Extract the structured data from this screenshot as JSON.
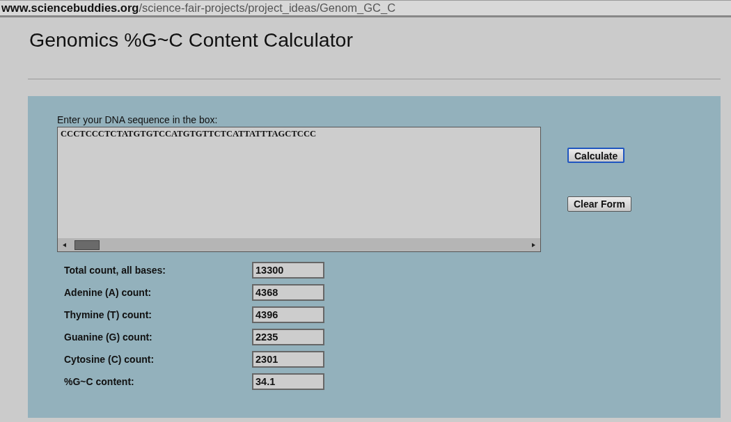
{
  "address_bar": {
    "domain": "www.sciencebuddies.org",
    "path": "/science-fair-projects/project_ideas/Genom_GC_C"
  },
  "page_title": "Genomics %G~C Content Calculator",
  "form": {
    "sequence_label": "Enter your DNA sequence in the box:",
    "sequence_value": "CCCTCCCTCTATGTGTCCATGTGTTCTCATTATTTAGCTCCC",
    "buttons": [
      {
        "label": "Calculate",
        "focused": true
      },
      {
        "label": "Clear Form",
        "focused": false
      }
    ],
    "results": [
      {
        "label": "Total count, all bases:",
        "value": "13300"
      },
      {
        "label": "Adenine (A) count:",
        "value": "4368"
      },
      {
        "label": "Thymine (T) count:",
        "value": "4396"
      },
      {
        "label": "Guanine (G) count:",
        "value": "2235"
      },
      {
        "label": "Cytosine (C) count:",
        "value": "2301"
      },
      {
        "label": "%G~C content:",
        "value": "34.1"
      }
    ]
  }
}
